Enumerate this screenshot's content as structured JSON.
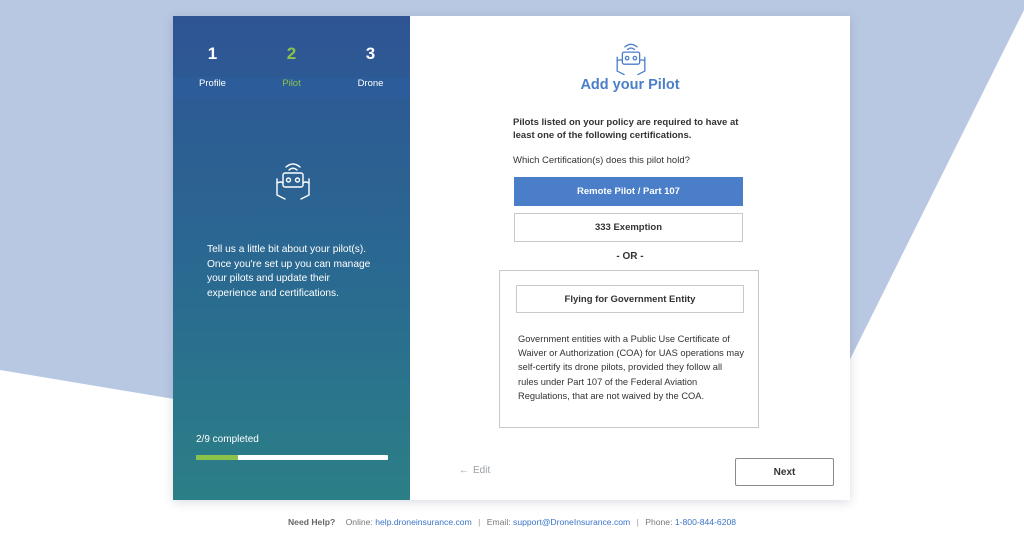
{
  "steps": [
    {
      "number": "1",
      "label": "Profile",
      "active": false
    },
    {
      "number": "2",
      "label": "Pilot",
      "active": true
    },
    {
      "number": "3",
      "label": "Drone",
      "active": false
    }
  ],
  "left_panel": {
    "icon": "pilot-controller-icon",
    "description": "Tell us a little bit about your pilot(s). Once you're set up you can manage your pilots and update their experience and certifications.",
    "progress_label": "2/9 completed",
    "progress_fraction": 0.22
  },
  "main": {
    "icon": "pilot-controller-icon",
    "title": "Add your Pilot",
    "intro": "Pilots listed on your policy are required to have at least one of the following certifications.",
    "question": "Which Certification(s) does this pilot hold?",
    "options": [
      {
        "label": "Remote Pilot / Part 107",
        "selected": true
      },
      {
        "label": "333 Exemption",
        "selected": false
      }
    ],
    "or_label": "- OR -",
    "gov_option": {
      "label": "Flying for Government Entity",
      "description": "Government entities with a Public Use Certificate of Waiver or Authorization (COA) for UAS operations may self-certify its drone pilots, provided they follow all rules under Part 107 of the Federal Aviation Regulations, that are not waived by the COA."
    },
    "edit_label": "Edit",
    "next_label": "Next"
  },
  "footer": {
    "help_label": "Need Help?",
    "online_label": "Online:",
    "online_link": "help.droneinsurance.com",
    "email_label": "Email:",
    "email_link": "support@DroneInsurance.com",
    "phone_label": "Phone:",
    "phone_link": "1-800-844-6208"
  },
  "colors": {
    "accent": "#4a7ec9",
    "active_step": "#8bc34a",
    "panel_top": "#2e5494",
    "panel_bottom": "#2b7f86"
  }
}
